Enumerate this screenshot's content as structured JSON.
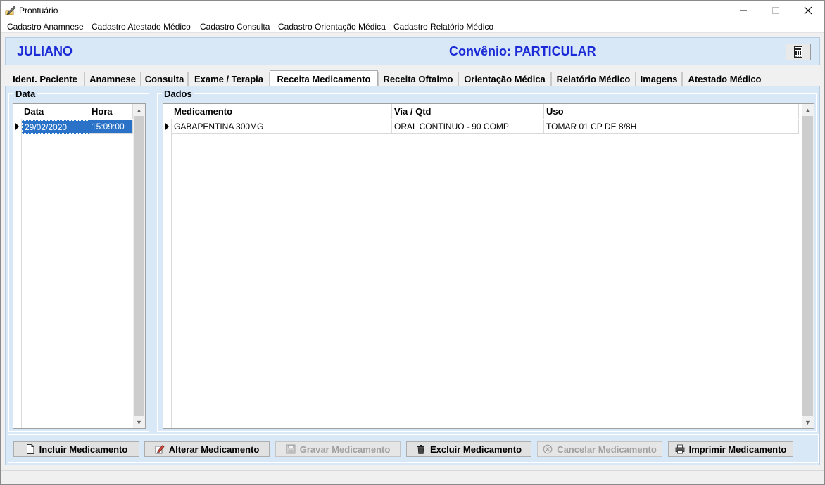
{
  "window": {
    "title": "Prontuário"
  },
  "menu": {
    "items": [
      {
        "label": "Cadastro Anamnese"
      },
      {
        "label": "Cadastro Atestado Médico"
      },
      {
        "label": "Cadastro Consulta"
      },
      {
        "label": "Cadastro Orientação Médica"
      },
      {
        "label": "Cadastro Relatório Médico"
      }
    ]
  },
  "header": {
    "patient_name": "JULIANO",
    "convenio": "Convênio: PARTICULAR"
  },
  "tabs": [
    {
      "label": "Ident. Paciente"
    },
    {
      "label": "Anamnese"
    },
    {
      "label": "Consulta"
    },
    {
      "label": "Exame / Terapia"
    },
    {
      "label": "Receita Medicamento"
    },
    {
      "label": "Receita Oftalmo"
    },
    {
      "label": "Orientação Médica"
    },
    {
      "label": "Relatório Médico"
    },
    {
      "label": "Imagens"
    },
    {
      "label": "Atestado Médico"
    }
  ],
  "active_tab": "Receita Medicamento",
  "data_group": {
    "title": "Data",
    "columns": [
      "Data",
      "Hora"
    ],
    "rows": [
      {
        "data": "29/02/2020",
        "hora": "15:09:00"
      }
    ]
  },
  "dados_group": {
    "title": "Dados",
    "columns": [
      "Medicamento",
      "Via / Qtd",
      "Uso"
    ],
    "rows": [
      {
        "medicamento": "GABAPENTINA 300MG",
        "via": "ORAL CONTINUO - 90 COMP",
        "uso": "TOMAR 01 CP DE 8/8H"
      }
    ]
  },
  "buttons": {
    "incluir": "Incluir Medicamento",
    "alterar": "Alterar Medicamento",
    "gravar": "Gravar Medicamento",
    "excluir": "Excluir Medicamento",
    "cancelar": "Cancelar Medicamento",
    "imprimir": "Imprimir Medicamento"
  },
  "colors": {
    "accent_text": "#1a2ad6",
    "panel_bg": "#d8e8f7",
    "selection": "#2a72c7"
  }
}
